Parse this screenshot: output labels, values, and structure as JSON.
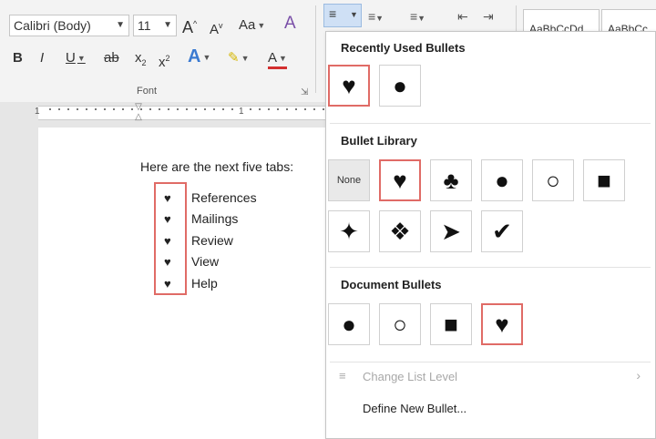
{
  "ribbon": {
    "font_name": "Calibri (Body)",
    "font_size": "11",
    "grow_font": "A",
    "shrink_font": "A",
    "change_case": "Aa",
    "bold": "B",
    "italic": "I",
    "underline": "U",
    "strikethrough": "ab",
    "subscript": "x",
    "superscript": "x",
    "text_effects": "A",
    "highlight": "✎",
    "font_color": "A",
    "clear_format": "A",
    "font_group_label": "Font",
    "dialog_launcher": "⇲",
    "style_samples": [
      "AaBbCcDd",
      "AaBbCc"
    ]
  },
  "ruler": {
    "numbers": [
      "1",
      "1"
    ]
  },
  "document": {
    "intro_text": "Here are the next five tabs:",
    "bullet_glyph": "♥",
    "items": [
      "References",
      "Mailings",
      "Review",
      "View",
      "Help"
    ]
  },
  "dropdown": {
    "recent_heading": "Recently Used Bullets",
    "recent": [
      {
        "glyph": "♥",
        "selected": true
      },
      {
        "glyph": "●",
        "selected": false
      }
    ],
    "library_heading": "Bullet Library",
    "library": [
      {
        "glyph": "None",
        "selected": false,
        "none": true
      },
      {
        "glyph": "♥",
        "selected": true
      },
      {
        "glyph": "♣",
        "selected": false
      },
      {
        "glyph": "●",
        "selected": false
      },
      {
        "glyph": "○",
        "selected": false
      },
      {
        "glyph": "■",
        "selected": false
      },
      {
        "glyph": "✦",
        "selected": false
      },
      {
        "glyph": "❖",
        "selected": false
      },
      {
        "glyph": "➤",
        "selected": false
      },
      {
        "glyph": "✔",
        "selected": false
      }
    ],
    "document_heading": "Document Bullets",
    "document": [
      {
        "glyph": "●",
        "selected": false
      },
      {
        "glyph": "○",
        "selected": false
      },
      {
        "glyph": "■",
        "selected": false
      },
      {
        "glyph": "♥",
        "selected": true
      }
    ],
    "change_level": "Change List Level",
    "define_new": "Define New Bullet..."
  },
  "colors": {
    "highlight_red": "#e06b66",
    "selected_blue": "#cfe0f5"
  }
}
